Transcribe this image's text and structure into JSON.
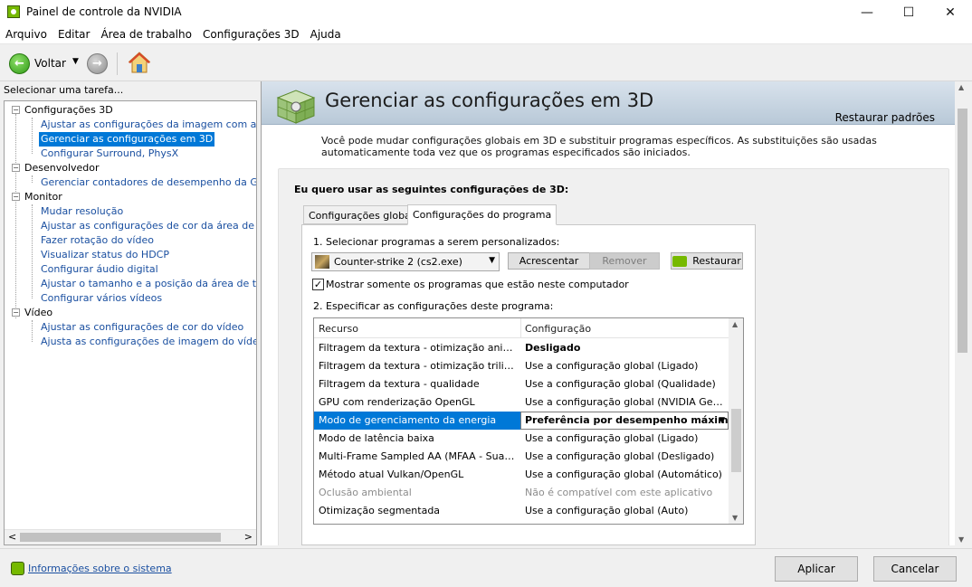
{
  "window": {
    "title": "Painel de controle da NVIDIA",
    "minimize": "—",
    "maximize": "☐",
    "close": "✕"
  },
  "menu": [
    "Arquivo",
    "Editar",
    "Área de trabalho",
    "Configurações 3D",
    "Ajuda"
  ],
  "toolbar": {
    "back_label": "Voltar",
    "back_dropdown": "▼",
    "back_arrow": "←",
    "forward_arrow": "→"
  },
  "sidebar": {
    "task_label": "Selecionar uma tarefa...",
    "tree": [
      {
        "label": "Configurações 3D",
        "type": "cat",
        "expander": "−"
      },
      {
        "label": "Ajustar as configurações da imagem com a Visualização",
        "type": "link"
      },
      {
        "label": "Gerenciar as configurações em 3D",
        "type": "link",
        "selected": true
      },
      {
        "label": "Configurar Surround, PhysX",
        "type": "link"
      },
      {
        "label": "Desenvolvedor",
        "type": "cat",
        "expander": "−"
      },
      {
        "label": "Gerenciar contadores de desempenho da GPU",
        "type": "link"
      },
      {
        "label": "Monitor",
        "type": "cat",
        "expander": "−"
      },
      {
        "label": "Mudar resolução",
        "type": "link"
      },
      {
        "label": "Ajustar as configurações de cor da área de trabalho",
        "type": "link"
      },
      {
        "label": "Fazer rotação do vídeo",
        "type": "link"
      },
      {
        "label": "Visualizar status do HDCP",
        "type": "link"
      },
      {
        "label": "Configurar áudio digital",
        "type": "link"
      },
      {
        "label": "Ajustar o tamanho e a posição da área de trabalho",
        "type": "link"
      },
      {
        "label": "Configurar vários vídeos",
        "type": "link"
      },
      {
        "label": "Vídeo",
        "type": "cat",
        "expander": "−"
      },
      {
        "label": "Ajustar as configurações de cor do vídeo",
        "type": "link"
      },
      {
        "label": "Ajusta as configurações de imagem do vídeo",
        "type": "link"
      }
    ],
    "scroll_left": "<",
    "scroll_right": ">"
  },
  "main": {
    "title": "Gerenciar as configurações em 3D",
    "restore_defaults": "Restaurar padrões",
    "description": "Você pode mudar configurações globais em 3D e substituir programas específicos. As substituições são usadas automaticamente toda vez que os programas especificados são iniciados.",
    "section_heading": "Eu quero usar as seguintes configurações de 3D:",
    "tabs": [
      {
        "label": "Configurações globais"
      },
      {
        "label": "Configurações do programa",
        "active": true
      }
    ],
    "step1_label": "1. Selecionar programas a serem personalizados:",
    "program_value": "Counter-strike 2 (cs2.exe)",
    "add_button": "Acrescentar",
    "remove_button": "Remover",
    "restore_button": "Restaurar",
    "checkbox_label": "Mostrar somente os programas que estão neste computador",
    "checkbox_mark": "✓",
    "step2_label": "2. Especificar as configurações deste programa:",
    "table": {
      "col_resource": "Recurso",
      "col_config": "Configuração",
      "rows": [
        {
          "resource": "Filtragem da textura - otimização anisotrópica",
          "config": "Desligado",
          "bold": true
        },
        {
          "resource": "Filtragem da textura - otimização trilinear",
          "config": "Use a configuração global (Ligado)"
        },
        {
          "resource": "Filtragem da textura - qualidade",
          "config": "Use a configuração global (Qualidade)"
        },
        {
          "resource": "GPU com renderização OpenGL",
          "config": "Use a configuração global (NVIDIA GeForce)"
        },
        {
          "resource": "Modo de gerenciamento da energia",
          "config": "Preferência por desempenho máximo",
          "selected": true
        },
        {
          "resource": "Modo de latência baixa",
          "config": "Use a configuração global (Ligado)"
        },
        {
          "resource": "Multi-Frame Sampled AA (MFAA - Suavização)",
          "config": "Use a configuração global (Desligado)"
        },
        {
          "resource": "Método atual Vulkan/OpenGL",
          "config": "Use a configuração global (Automático)"
        },
        {
          "resource": "Oclusão ambiental",
          "config": "Não é compatível com este aplicativo",
          "disabled": true
        },
        {
          "resource": "Otimização segmentada",
          "config": "Use a configuração global (Auto)"
        }
      ],
      "scroll_up": "▲",
      "scroll_down": "▼"
    }
  },
  "footer": {
    "sysinfo_link": "Informações sobre o sistema",
    "apply_button": "Aplicar",
    "cancel_button": "Cancelar"
  }
}
